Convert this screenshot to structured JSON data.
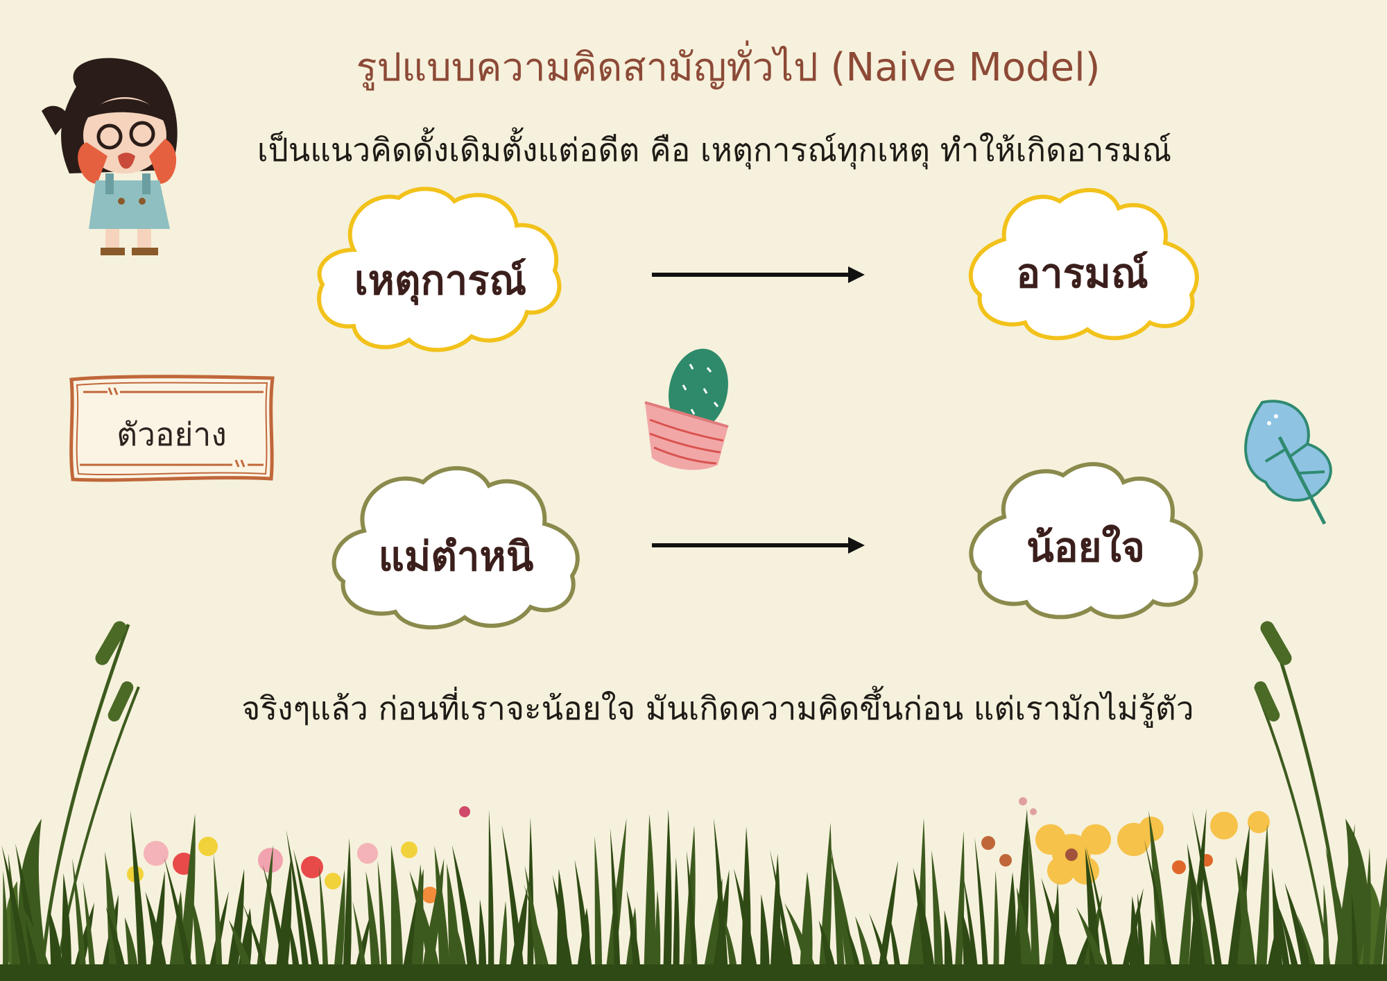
{
  "title": "รูปแบบความคิดสามัญทั่วไป (Naive Model)",
  "subtitle": "เป็นแนวคิดดั้งเดิมตั้งแต่อดีต คือ เหตุการณ์ทุกเหตุ ทำให้เกิดอารมณ์",
  "model": {
    "cause_label": "เหตุการณ์",
    "effect_label": "อารมณ์"
  },
  "example": {
    "tag_label": "ตัวอย่าง",
    "cause_label": "แม่ตำหนิ",
    "effect_label": "น้อยใจ"
  },
  "footer": "จริงๆแล้ว ก่อนที่เราจะน้อยใจ มันเกิดความคิดขึ้นก่อน แต่เรามักไม่รู้ตัว",
  "colors": {
    "background": "#f6f1dc",
    "title": "#8c4a36",
    "cloud_yellow_border": "#f2c21b",
    "cloud_olive_border": "#8a8a4c",
    "tag_border": "#c0673a",
    "grass": "#3d5a1e"
  },
  "icons": [
    "crying-girl-icon",
    "cactus-icon",
    "leaf-icon",
    "flower-icon",
    "grass-icon",
    "cattail-icon"
  ]
}
